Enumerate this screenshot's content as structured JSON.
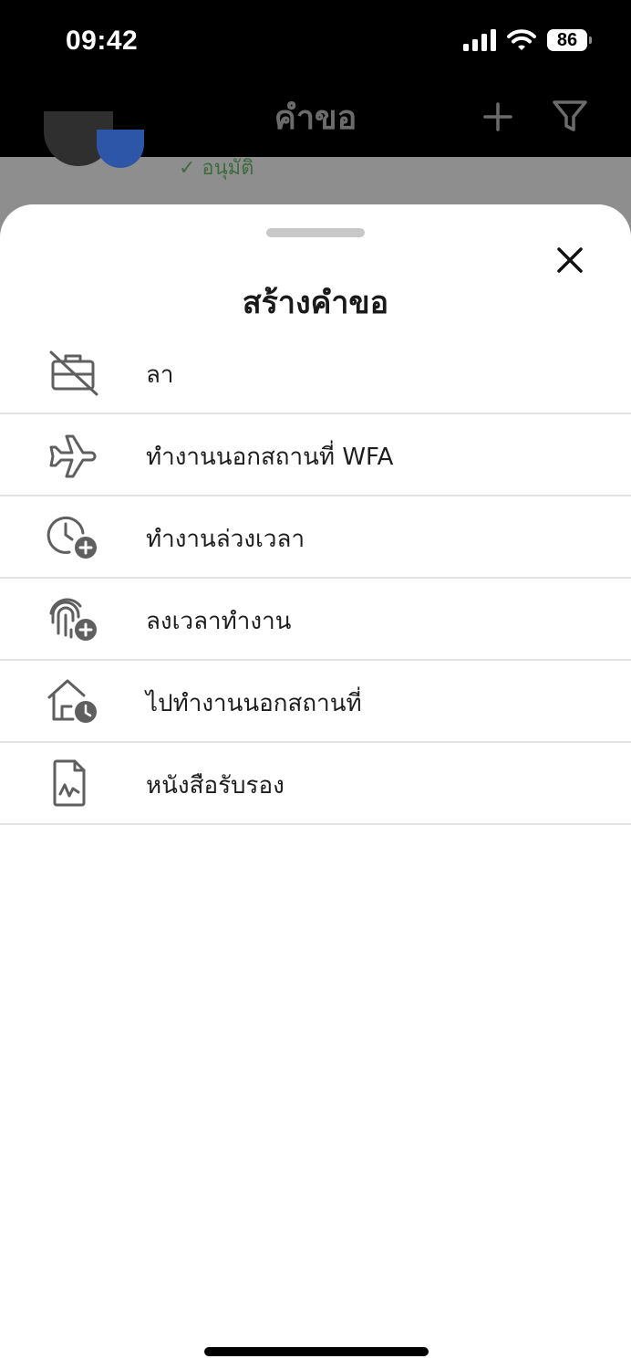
{
  "status_bar": {
    "time": "09:42",
    "battery": "86",
    "icons": [
      "signal-icon",
      "wifi-icon",
      "battery-icon"
    ]
  },
  "nav": {
    "title": "คำขอ",
    "icons": [
      "plus-icon",
      "filter-icon"
    ]
  },
  "background": {
    "status_text": "✓ อนุมัติ",
    "status_color": "#3f6b3f"
  },
  "sheet": {
    "title": "สร้างคำขอ",
    "close_icon": "close-icon",
    "items": [
      {
        "label": "ลา",
        "icon": "briefcase-off-icon"
      },
      {
        "label": "ทำงานนอกสถานที่ WFA",
        "icon": "airplane-icon"
      },
      {
        "label": "ทำงานล่วงเวลา",
        "icon": "clock-plus-icon"
      },
      {
        "label": "ลงเวลาทำงาน",
        "icon": "fingerprint-plus-icon"
      },
      {
        "label": "ไปทำงานนอกสถานที่",
        "icon": "home-clock-icon"
      },
      {
        "label": "หนังสือรับรอง",
        "icon": "document-icon"
      }
    ]
  },
  "colors": {
    "accent_text": "#1e1e1e",
    "icon_gray": "#5f5f5f",
    "overlay": "#8e8e8e",
    "approved_green": "#3f6b3f"
  }
}
